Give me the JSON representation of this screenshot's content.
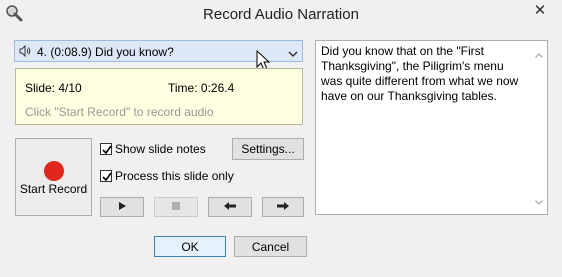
{
  "window": {
    "title": "Record Audio Narration",
    "close_glyph": "✕",
    "app_icon": "magnifier-icon"
  },
  "slide_select": {
    "value": "4. (0:08.9) Did you know?",
    "icon": "speaker-icon"
  },
  "info": {
    "slide": "Slide: 4/10",
    "time": "Time: 0:26.4",
    "hint": "Click \"Start Record\" to record audio"
  },
  "record_button": {
    "label": "Start Record",
    "color": "#e0271d"
  },
  "options": {
    "show_notes": {
      "label": "Show slide notes",
      "checked": true
    },
    "this_slide_only": {
      "label": "Process this slide only",
      "checked": true
    }
  },
  "settings_button": "Settings...",
  "playback": {
    "play": "play-icon",
    "stop": "stop-icon",
    "prev": "arrow-left-icon",
    "next": "arrow-right-icon"
  },
  "notes": {
    "text": "Did you know that on the \"First Thanksgiving\", the Piligrim's menu was quite different from what we now have on our Thanksgiving tables."
  },
  "footer": {
    "ok": "OK",
    "cancel": "Cancel"
  }
}
